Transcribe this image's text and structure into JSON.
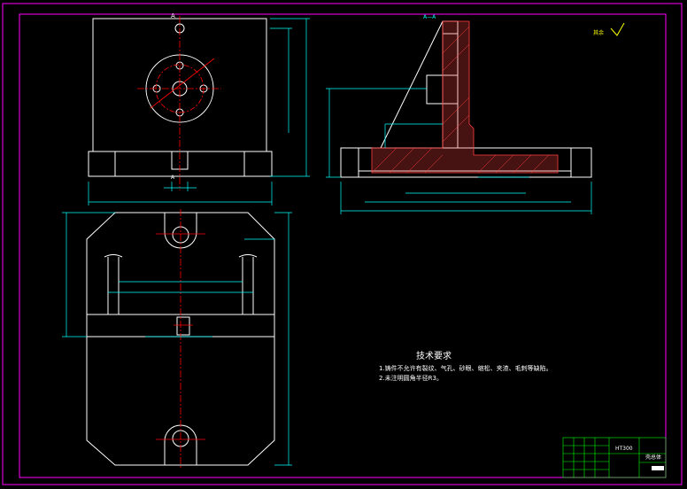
{
  "drawing": {
    "view_label_top": "A",
    "view_label_bottom": "A",
    "section_label": "A—A",
    "surface_roughness_note": "其余",
    "colors": {
      "background": "#000000",
      "frame": "#ff00ff",
      "outline": "#ffffff",
      "dimension": "#00ffff",
      "centerline": "#ff0000",
      "hatch": "#ff4040",
      "roughness": "#ffff00",
      "titleblock_grid": "#00ff00"
    }
  },
  "technical_requirements": {
    "title": "技术要求",
    "items": [
      "1.铸件不允许有裂纹、气孔、砂眼、缩松、夹渣、毛刺等缺陷。",
      "2.未注明圆角半径R3。"
    ]
  },
  "title_block": {
    "material": "HT300",
    "part_name": "壳总体"
  }
}
